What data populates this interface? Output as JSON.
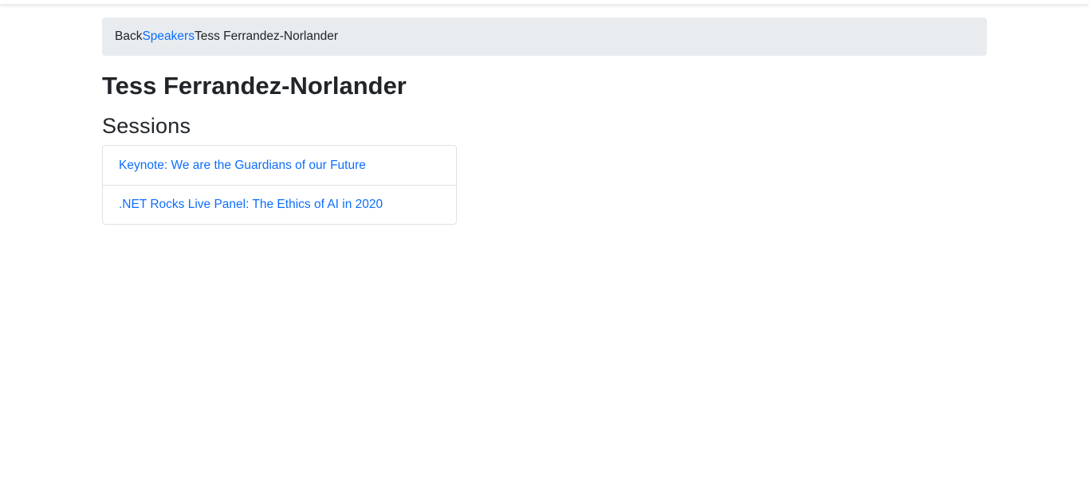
{
  "breadcrumb": {
    "back": "Back",
    "speakers": "Speakers",
    "current": "Tess Ferrandez-Norlander"
  },
  "page": {
    "title": "Tess Ferrandez-Norlander",
    "sessions_heading": "Sessions"
  },
  "sessions": [
    {
      "title": "Keynote: We are the Guardians of our Future"
    },
    {
      "title": ".NET Rocks Live Panel: The Ethics of AI in 2020"
    }
  ],
  "colors": {
    "link": "#0d6efd",
    "breadcrumb_bg": "#e9ecef",
    "text": "#212529",
    "border": "#dee2e6"
  }
}
